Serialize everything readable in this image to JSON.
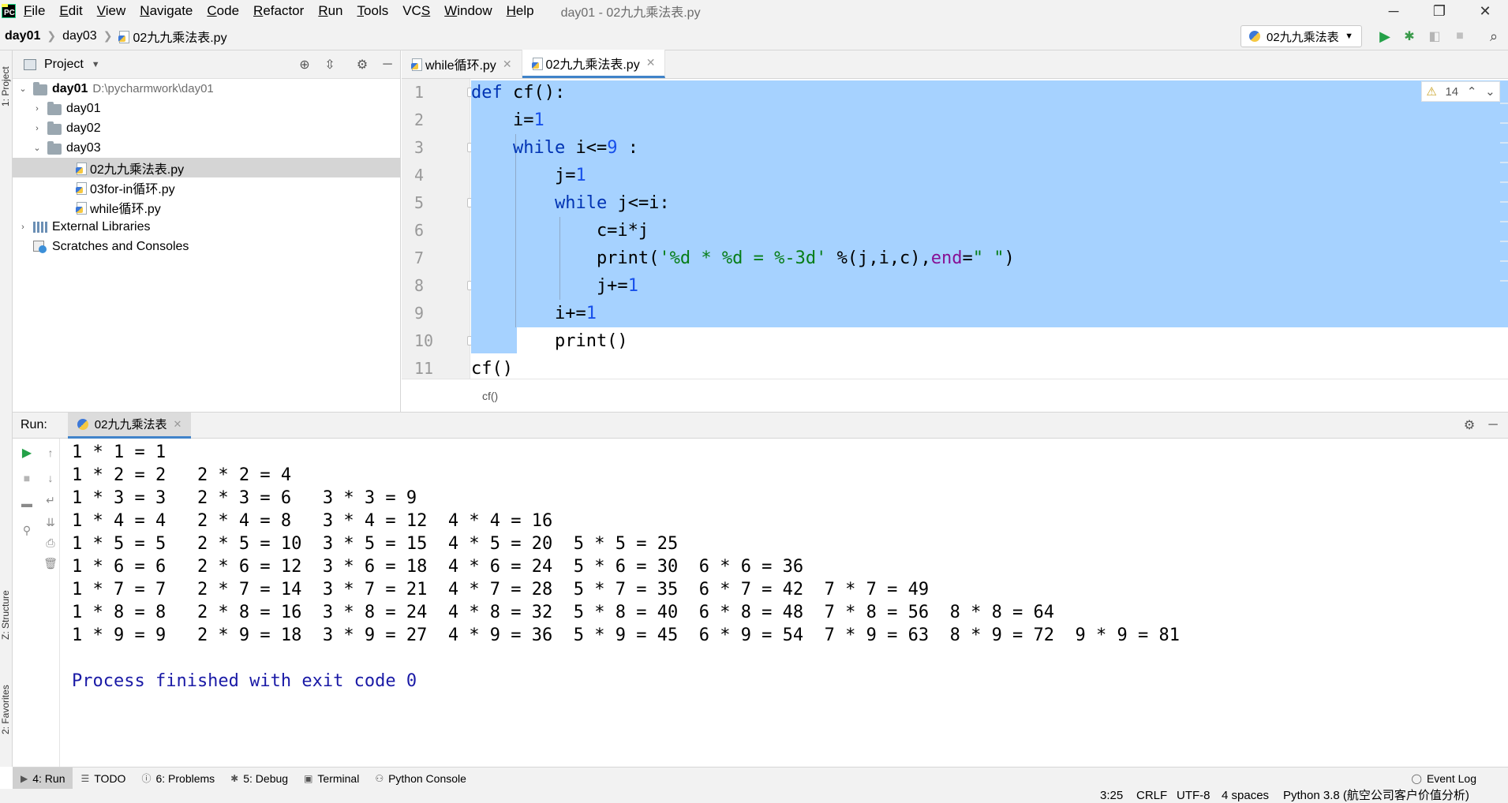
{
  "menubar": {
    "logo": "PC",
    "items": [
      "File",
      "Edit",
      "View",
      "Navigate",
      "Code",
      "Refactor",
      "Run",
      "Tools",
      "VCS",
      "Window",
      "Help"
    ],
    "mnemonics": [
      "F",
      "E",
      "V",
      "N",
      "C",
      "R",
      "R",
      "T",
      "S",
      "W",
      "H"
    ],
    "window_title": "day01 - 02九九乘法表.py",
    "controls": {
      "minimize": "─",
      "restore": "❐",
      "close": "✕"
    }
  },
  "navbar": {
    "crumbs": [
      "day01",
      "day03",
      "02九九乘法表.py"
    ],
    "run_config": "02九九乘法表"
  },
  "left_strip": {
    "project": "1: Project",
    "structure": "Z: Structure",
    "favorites": "2: Favorites"
  },
  "project": {
    "title": "Project",
    "tree": [
      {
        "label": "day01",
        "path": "D:\\pycharmwork\\day01",
        "type": "folder",
        "expanded": true,
        "bold": true
      },
      {
        "label": "day01",
        "type": "folder",
        "expanded": false
      },
      {
        "label": "day02",
        "type": "folder",
        "expanded": false
      },
      {
        "label": "day03",
        "type": "folder",
        "expanded": true
      },
      {
        "label": "02九九乘法表.py",
        "type": "pyfile",
        "selected": true
      },
      {
        "label": "03for-in循环.py",
        "type": "pyfile"
      },
      {
        "label": "while循环.py",
        "type": "pyfile"
      },
      {
        "label": "External Libraries",
        "type": "lib",
        "expanded": false
      },
      {
        "label": "Scratches and Consoles",
        "type": "scratch"
      }
    ]
  },
  "editor": {
    "tabs": [
      {
        "label": "while循环.py",
        "active": false
      },
      {
        "label": "02九九乘法表.py",
        "active": true
      }
    ],
    "warning_count": "14",
    "line_numbers": [
      "1",
      "2",
      "3",
      "4",
      "5",
      "6",
      "7",
      "8",
      "9",
      "10",
      "11"
    ],
    "code_lines": [
      "def cf():",
      "    i=1",
      "    while i<=9 :",
      "        j=1",
      "        while j<=i:",
      "            c=i*j",
      "            print('%d * %d = %-3d' %(j,i,c),end=\" \")",
      "            j+=1",
      "        i+=1",
      "        print()",
      "cf()"
    ],
    "breadcrumb": "cf()"
  },
  "run_panel": {
    "label": "Run:",
    "tab": "02九九乘法表",
    "output": [
      "1 * 1 = 1",
      "1 * 2 = 2   2 * 2 = 4",
      "1 * 3 = 3   2 * 3 = 6   3 * 3 = 9",
      "1 * 4 = 4   2 * 4 = 8   3 * 4 = 12  4 * 4 = 16",
      "1 * 5 = 5   2 * 5 = 10  3 * 5 = 15  4 * 5 = 20  5 * 5 = 25",
      "1 * 6 = 6   2 * 6 = 12  3 * 6 = 18  4 * 6 = 24  5 * 6 = 30  6 * 6 = 36",
      "1 * 7 = 7   2 * 7 = 14  3 * 7 = 21  4 * 7 = 28  5 * 7 = 35  6 * 7 = 42  7 * 7 = 49",
      "1 * 8 = 8   2 * 8 = 16  3 * 8 = 24  4 * 8 = 32  5 * 8 = 40  6 * 8 = 48  7 * 8 = 56  8 * 8 = 64",
      "1 * 9 = 9   2 * 9 = 18  3 * 9 = 27  4 * 9 = 36  5 * 9 = 45  6 * 9 = 54  7 * 9 = 63  8 * 9 = 72  9 * 9 = 81",
      "",
      "Process finished with exit code 0"
    ]
  },
  "bottom_tools": {
    "run": "4: Run",
    "todo": "TODO",
    "problems": "6: Problems",
    "debug": "5: Debug",
    "terminal": "Terminal",
    "python_console": "Python Console",
    "event_log": "Event Log"
  },
  "status": {
    "position": "3:25",
    "line_sep": "CRLF",
    "encoding": "UTF-8",
    "indent": "4 spaces",
    "interpreter": "Python 3.8 (航空公司客户价值分析)"
  },
  "colors": {
    "selection": "#a6d2ff",
    "keyword": "#0033b3",
    "number": "#1750eb",
    "string": "#067d17",
    "kwarg": "#871094",
    "exit_text": "#1a1aa6",
    "run_green": "#24a148",
    "accent_tab": "#4083c9"
  }
}
